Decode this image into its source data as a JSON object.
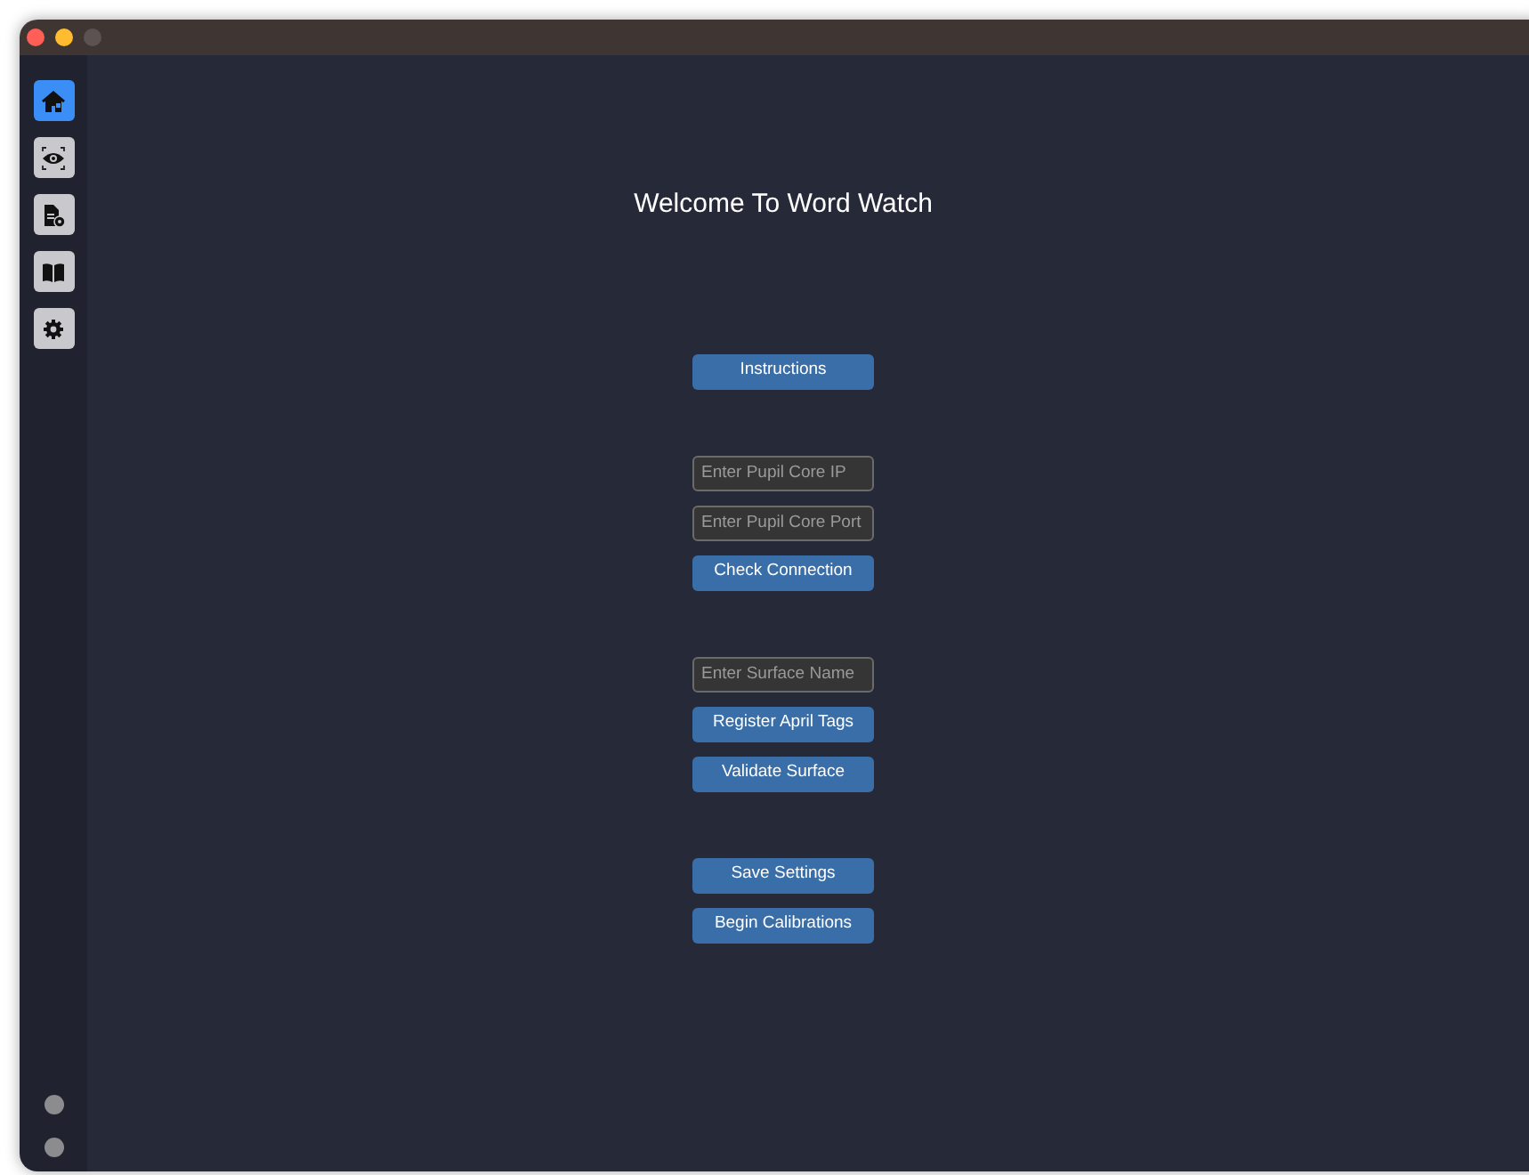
{
  "window": {
    "controls": [
      {
        "color": "#ff5f57"
      },
      {
        "color": "#febc2e"
      },
      {
        "color": "#5b5351"
      }
    ]
  },
  "sidebar": {
    "items": [
      {
        "selected": true
      },
      {
        "selected": false
      },
      {
        "selected": false
      },
      {
        "selected": false
      },
      {
        "selected": false
      }
    ],
    "status_dots": [
      {
        "color": "#8c8c8e"
      },
      {
        "color": "#8c8c8e"
      }
    ]
  },
  "title": "Welcome To Word Watch",
  "sections": [
    [
      {
        "kind": "button",
        "label": "Instructions"
      }
    ],
    [
      {
        "kind": "field",
        "placeholder": "Enter Pupil Core IP"
      },
      {
        "kind": "field",
        "placeholder": "Enter Pupil Core Port"
      },
      {
        "kind": "button",
        "label": "Check Connection"
      }
    ],
    [
      {
        "kind": "field",
        "placeholder": "Enter Surface Name"
      },
      {
        "kind": "button",
        "label": "Register April Tags"
      },
      {
        "kind": "button",
        "label": "Validate Surface"
      }
    ],
    [
      {
        "kind": "button",
        "label": "Save Settings"
      },
      {
        "kind": "button",
        "label": "Begin Calibrations"
      }
    ]
  ]
}
